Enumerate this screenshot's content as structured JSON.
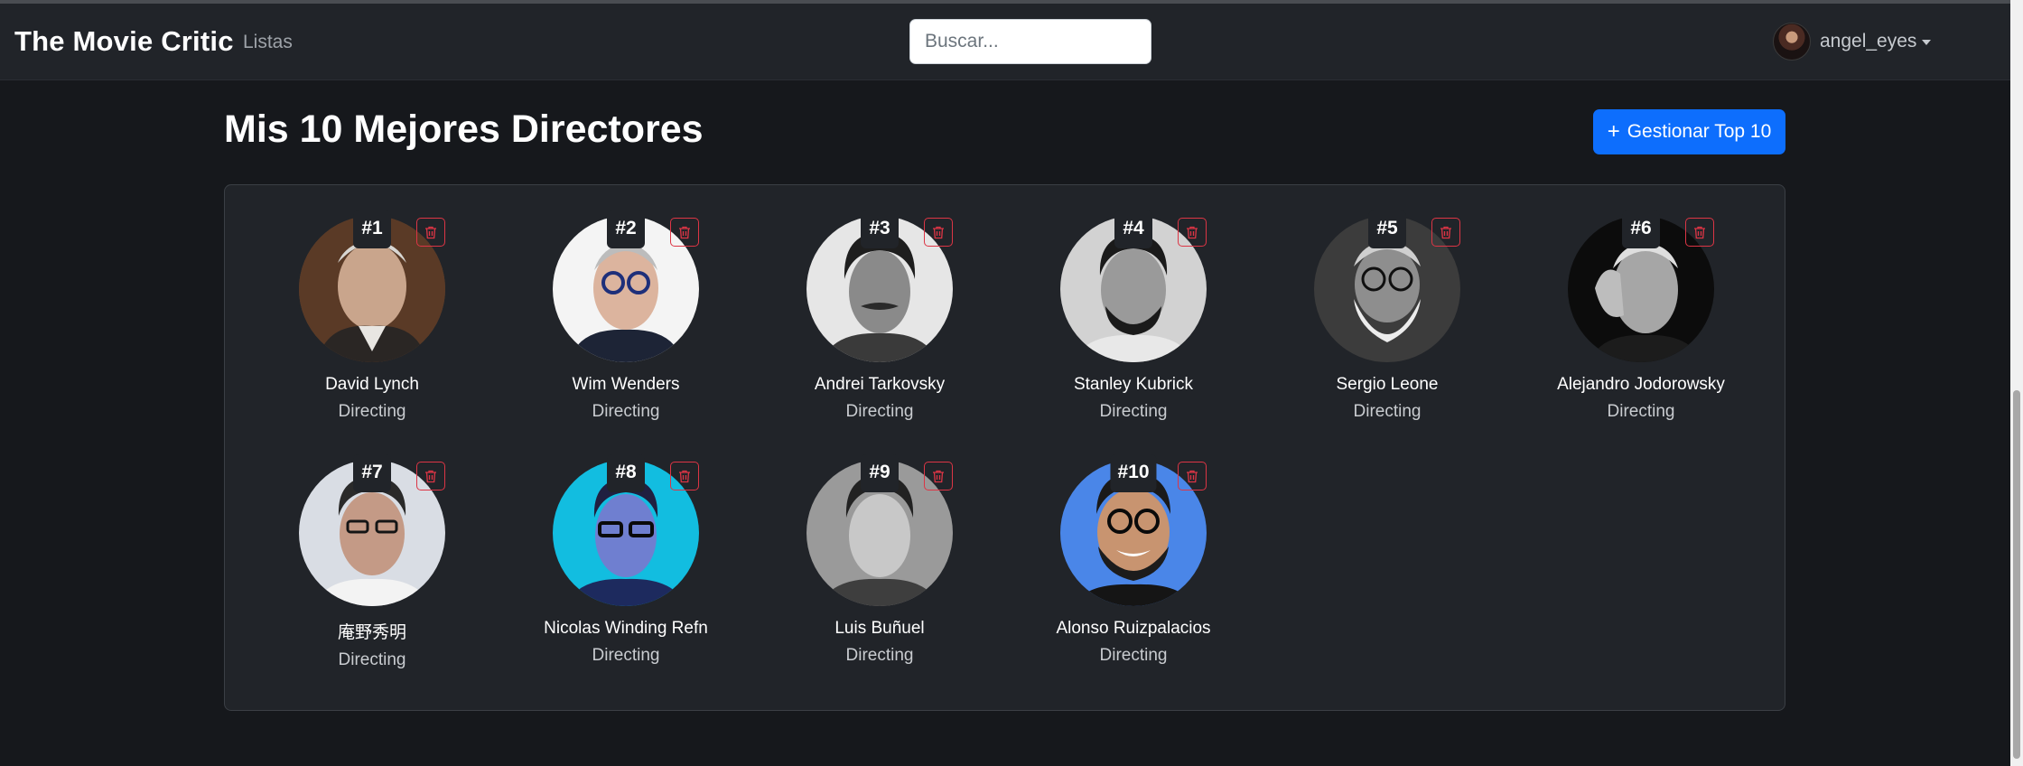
{
  "navbar": {
    "brand": "The Movie Critic",
    "lists_link": "Listas",
    "search_placeholder": "Buscar...",
    "username": "angel_eyes"
  },
  "main": {
    "title": "Mis 10 Mejores Directores",
    "manage_button": "Gestionar Top 10",
    "manage_button_icon": "plus-icon"
  },
  "colors": {
    "accent": "#0d6efd",
    "danger": "#dc3545",
    "background": "#16181c",
    "navbar": "#212429"
  },
  "directors": [
    {
      "rank": "#1",
      "name": "David Lynch",
      "department": "Directing"
    },
    {
      "rank": "#2",
      "name": "Wim Wenders",
      "department": "Directing"
    },
    {
      "rank": "#3",
      "name": "Andrei Tarkovsky",
      "department": "Directing"
    },
    {
      "rank": "#4",
      "name": "Stanley Kubrick",
      "department": "Directing"
    },
    {
      "rank": "#5",
      "name": "Sergio Leone",
      "department": "Directing"
    },
    {
      "rank": "#6",
      "name": "Alejandro Jodorowsky",
      "department": "Directing"
    },
    {
      "rank": "#7",
      "name": "庵野秀明",
      "department": "Directing"
    },
    {
      "rank": "#8",
      "name": "Nicolas Winding Refn",
      "department": "Directing"
    },
    {
      "rank": "#9",
      "name": "Luis Buñuel",
      "department": "Directing"
    },
    {
      "rank": "#10",
      "name": "Alonso Ruizpalacios",
      "department": "Directing"
    }
  ]
}
